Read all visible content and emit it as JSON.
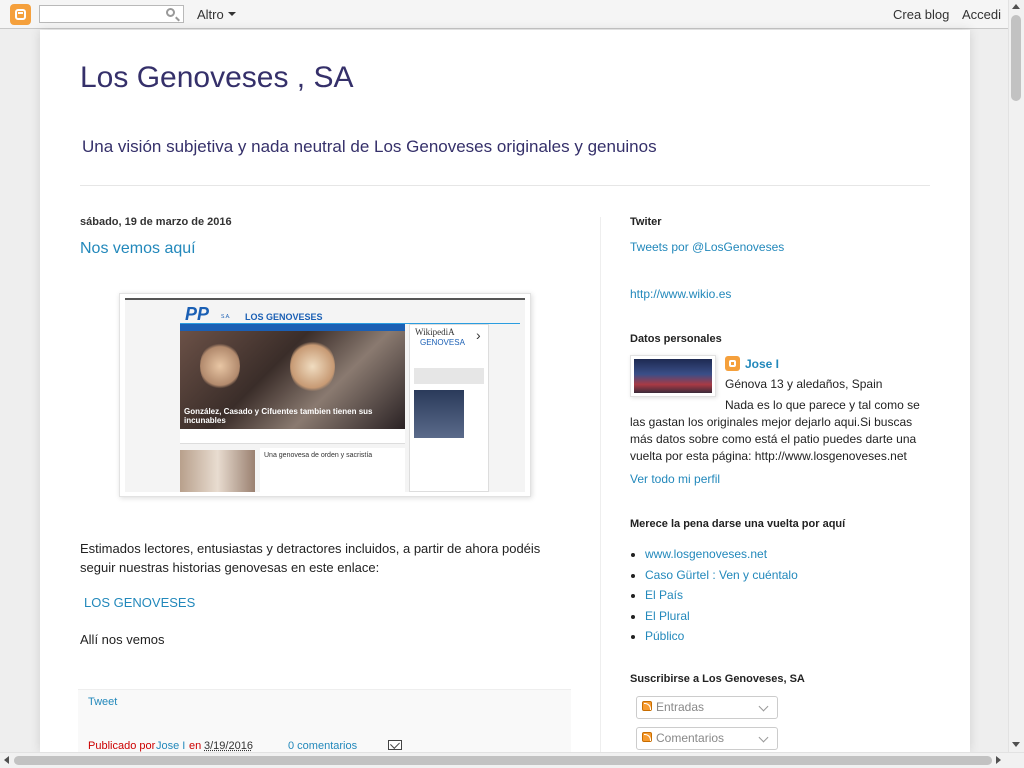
{
  "navbar": {
    "more_label": "Altro",
    "create_label": "Crea blog",
    "login_label": "Accedi"
  },
  "blog": {
    "title": "Los Genoveses , SA",
    "description": "Una visión subjetiva y nada neutral de Los Genoveses originales y genuinos"
  },
  "post": {
    "date": "sábado, 19 de marzo de 2016",
    "title": "Nos vemos aquí",
    "image": {
      "header": "LOS GENOVESES",
      "logo": "PP",
      "caption": "González, Casado y Cifuentes tambien tienen sus incunables",
      "article_title": "Una genovesa de orden y sacristía",
      "wiki": "WikipediA",
      "wiki_sub": "GENOVESA"
    },
    "body": "Estimados lectores, entusiastas y detractores incluidos, a partir de ahora podéis seguir nuestras historias genovesas en este enlace:",
    "link_text": "LOS GENOVESES",
    "closing": "Allí nos vemos",
    "footer": {
      "tweet_label": "Tweet",
      "published_by": "Publicado por",
      "author": "Jose I",
      "in_label": "en",
      "date": "3/19/2016",
      "comments": "0 comentarios"
    }
  },
  "sidebar": {
    "twitter": {
      "heading": "Twiter",
      "link": "Tweets por @LosGenoveses"
    },
    "wikio_alt": "http://www.wikio.es",
    "profile": {
      "heading": "Datos personales",
      "name": "Jose I",
      "location": "Génova 13 y aledaños, Spain",
      "about": "Nada es lo que parece y tal como se las gastan los originales mejor dejarlo aqui.Si buscas más datos sobre como está el patio puedes darte una vuelta por esta página: http://www.losgenoveses.net",
      "view_profile": "Ver todo mi perfil"
    },
    "links": {
      "heading": "Merece la pena darse una vuelta por aquí",
      "items": [
        "www.losgenoveses.net",
        "Caso Gürtel : Ven y cuéntalo",
        "El País",
        "El Plural",
        "Público"
      ]
    },
    "subscribe": {
      "heading": "Suscribirse a Los Genoveses, SA",
      "entries": "Entradas",
      "comments": "Comentarios"
    }
  },
  "colors": {
    "title": "#35306a",
    "link": "#2288bb",
    "blogger_orange": "#f5a03c",
    "footer_red": "#cc0000"
  }
}
